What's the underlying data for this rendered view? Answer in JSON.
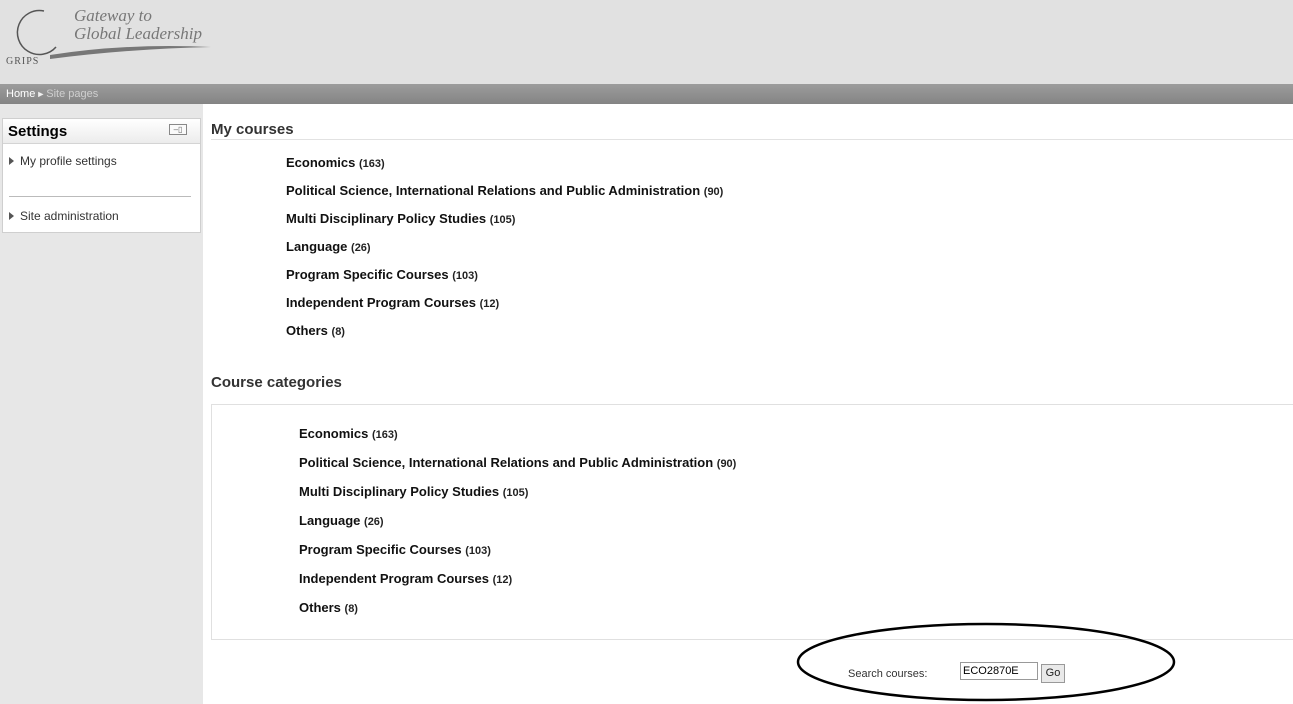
{
  "header": {
    "logo_line1": "Gateway to",
    "logo_line2": "Global Leadership",
    "logo_grips": "GRIPS"
  },
  "breadcrumb": {
    "home": "Home",
    "separator": "►",
    "current": "Site pages"
  },
  "settings": {
    "title": "Settings",
    "items": [
      {
        "label": "My profile settings"
      },
      {
        "label": "Site administration"
      }
    ]
  },
  "my_courses": {
    "heading": "My courses",
    "items": [
      {
        "name": "Economics",
        "count": "(163)"
      },
      {
        "name": "Political Science, International Relations and Public Administration",
        "count": "(90)"
      },
      {
        "name": "Multi Disciplinary Policy Studies",
        "count": "(105)"
      },
      {
        "name": "Language",
        "count": "(26)"
      },
      {
        "name": "Program Specific Courses",
        "count": "(103)"
      },
      {
        "name": "Independent Program Courses",
        "count": "(12)"
      },
      {
        "name": "Others",
        "count": "(8)"
      }
    ]
  },
  "course_categories": {
    "heading": "Course categories",
    "items": [
      {
        "name": "Economics",
        "count": "(163)"
      },
      {
        "name": "Political Science, International Relations and Public Administration",
        "count": "(90)"
      },
      {
        "name": "Multi Disciplinary Policy Studies",
        "count": "(105)"
      },
      {
        "name": "Language",
        "count": "(26)"
      },
      {
        "name": "Program Specific Courses",
        "count": "(103)"
      },
      {
        "name": "Independent Program Courses",
        "count": "(12)"
      },
      {
        "name": "Others",
        "count": "(8)"
      }
    ]
  },
  "search": {
    "label": "Search courses:",
    "value": "ECO2870E",
    "button": "Go"
  }
}
